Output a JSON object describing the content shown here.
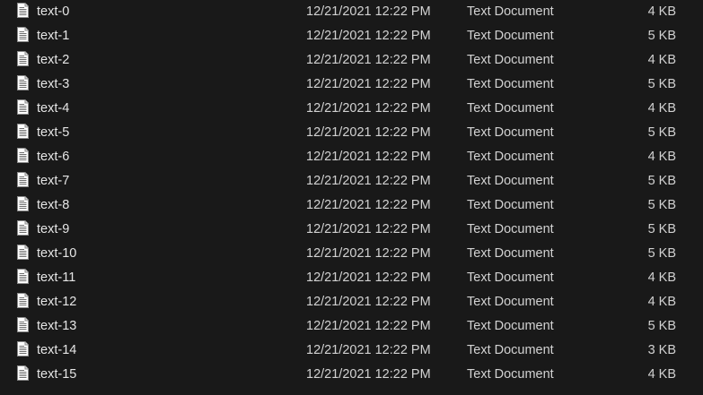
{
  "file_icon": "text-document-icon",
  "files": [
    {
      "name": "text-0",
      "date": "12/21/2021 12:22 PM",
      "type": "Text Document",
      "size": "4 KB"
    },
    {
      "name": "text-1",
      "date": "12/21/2021 12:22 PM",
      "type": "Text Document",
      "size": "5 KB"
    },
    {
      "name": "text-2",
      "date": "12/21/2021 12:22 PM",
      "type": "Text Document",
      "size": "4 KB"
    },
    {
      "name": "text-3",
      "date": "12/21/2021 12:22 PM",
      "type": "Text Document",
      "size": "5 KB"
    },
    {
      "name": "text-4",
      "date": "12/21/2021 12:22 PM",
      "type": "Text Document",
      "size": "4 KB"
    },
    {
      "name": "text-5",
      "date": "12/21/2021 12:22 PM",
      "type": "Text Document",
      "size": "5 KB"
    },
    {
      "name": "text-6",
      "date": "12/21/2021 12:22 PM",
      "type": "Text Document",
      "size": "4 KB"
    },
    {
      "name": "text-7",
      "date": "12/21/2021 12:22 PM",
      "type": "Text Document",
      "size": "5 KB"
    },
    {
      "name": "text-8",
      "date": "12/21/2021 12:22 PM",
      "type": "Text Document",
      "size": "5 KB"
    },
    {
      "name": "text-9",
      "date": "12/21/2021 12:22 PM",
      "type": "Text Document",
      "size": "5 KB"
    },
    {
      "name": "text-10",
      "date": "12/21/2021 12:22 PM",
      "type": "Text Document",
      "size": "5 KB"
    },
    {
      "name": "text-11",
      "date": "12/21/2021 12:22 PM",
      "type": "Text Document",
      "size": "4 KB"
    },
    {
      "name": "text-12",
      "date": "12/21/2021 12:22 PM",
      "type": "Text Document",
      "size": "4 KB"
    },
    {
      "name": "text-13",
      "date": "12/21/2021 12:22 PM",
      "type": "Text Document",
      "size": "5 KB"
    },
    {
      "name": "text-14",
      "date": "12/21/2021 12:22 PM",
      "type": "Text Document",
      "size": "3 KB"
    },
    {
      "name": "text-15",
      "date": "12/21/2021 12:22 PM",
      "type": "Text Document",
      "size": "4 KB"
    }
  ]
}
